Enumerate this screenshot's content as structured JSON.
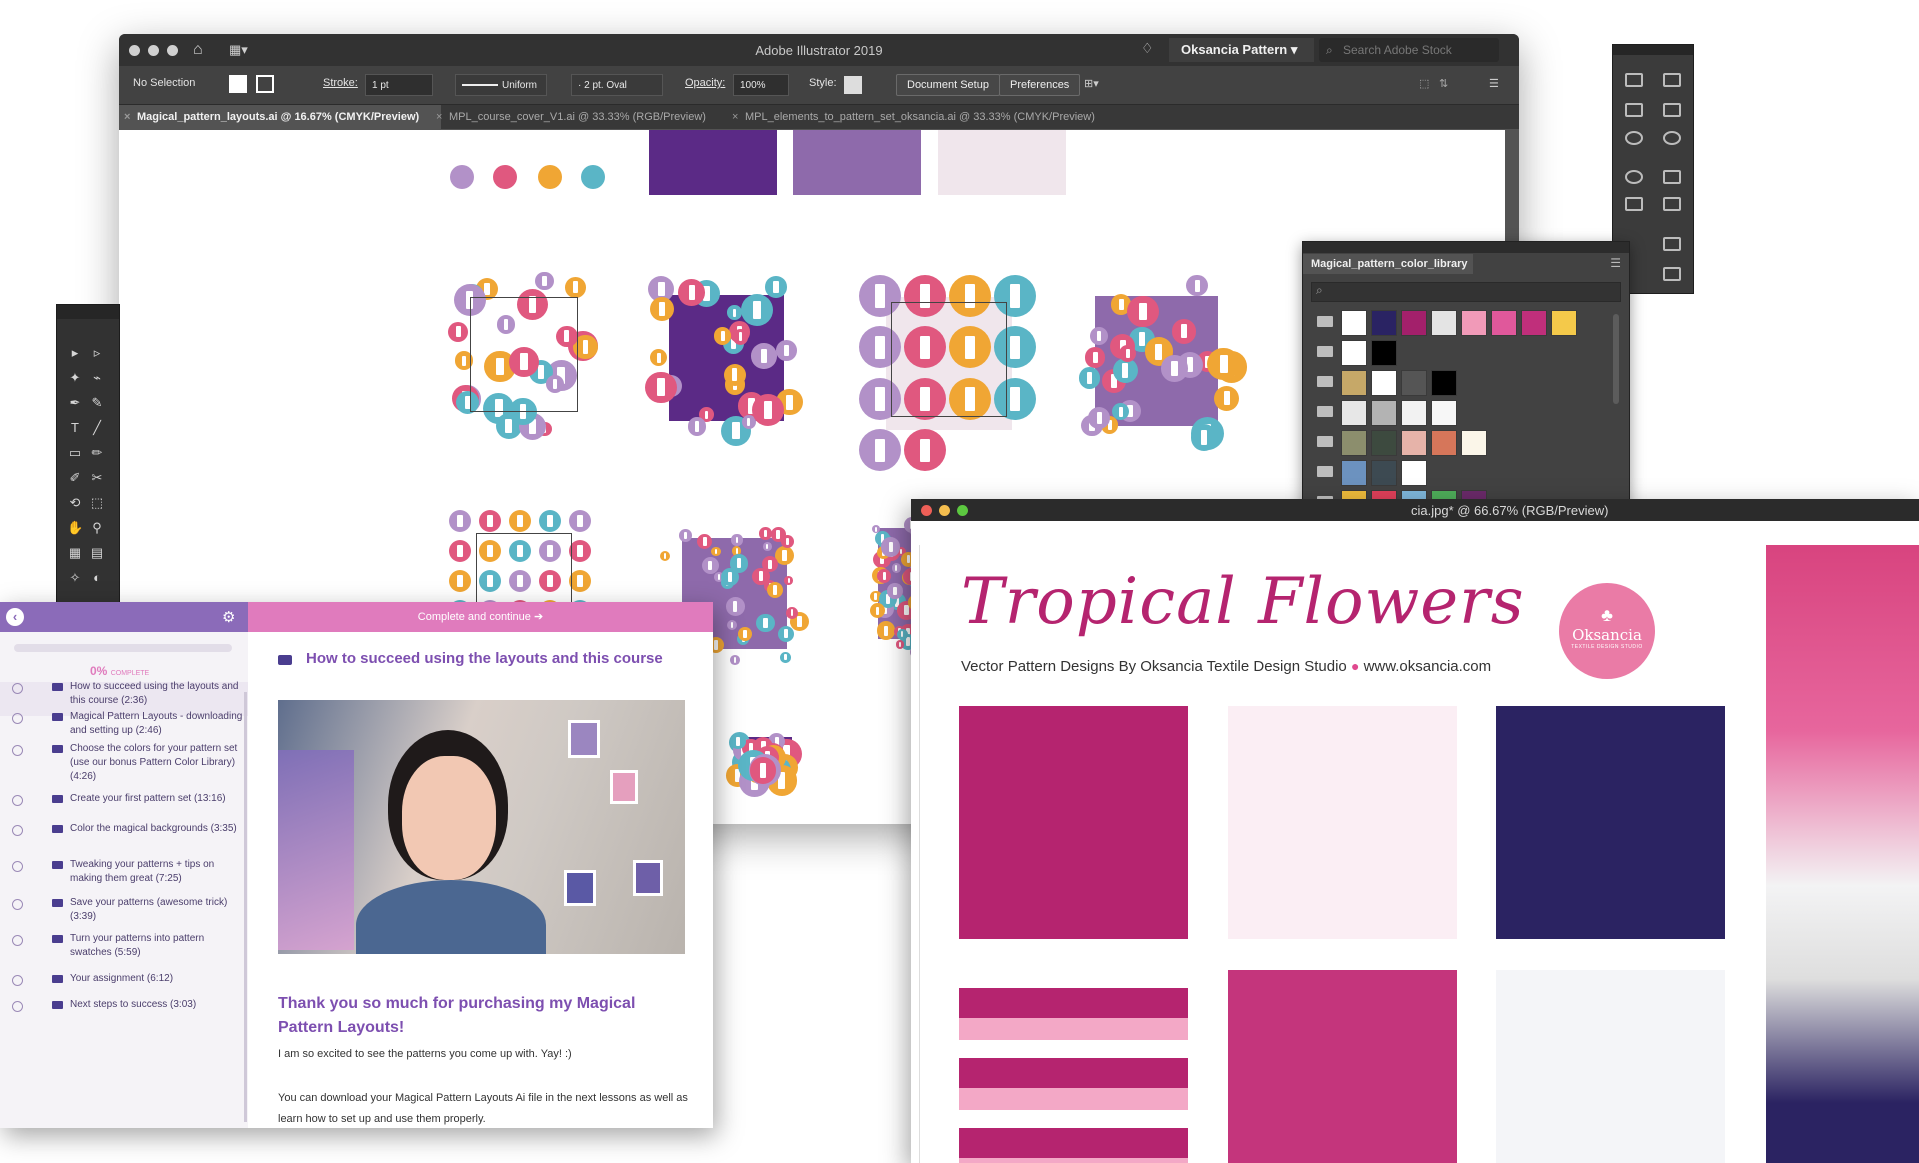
{
  "illustrator": {
    "app_title": "Adobe Illustrator 2019",
    "workspace": "Oksancia Pattern",
    "search_placeholder": "Search Adobe Stock",
    "control_bar": {
      "selection": "No Selection",
      "stroke_label": "Stroke:",
      "stroke_value": "1 pt",
      "profile": "Uniform",
      "brush": "2 pt. Oval",
      "opacity_label": "Opacity:",
      "opacity_value": "100%",
      "style_label": "Style:",
      "document_setup": "Document Setup",
      "preferences": "Preferences"
    },
    "tabs": [
      {
        "label": "Magical_pattern_layouts.ai @ 16.67% (CMYK/Preview)",
        "active": true
      },
      {
        "label": "MPL_course_cover_V1.ai @ 33.33% (RGB/Preview)",
        "active": false
      },
      {
        "label": "MPL_elements_to_pattern_set_oksancia.ai @ 33.33% (CMYK/Preview)",
        "active": false
      }
    ],
    "palette": [
      "#5b2a86",
      "#8e6aab",
      "#f0e6ec"
    ],
    "accent_colors": [
      "#b291c8",
      "#e0587f",
      "#f0a634",
      "#5ab5c6"
    ]
  },
  "swatches_panel": {
    "title": "Magical_pattern_color_library",
    "rows": [
      [
        "#ffffff",
        "#2a2363",
        "#a3206b",
        "#e4e4e4",
        "#f19ab8",
        "#e0589b",
        "#c02f7b",
        "#f4c94a"
      ],
      [
        "#ffffff",
        "#000000"
      ],
      [
        "#c6a868",
        "#ffffff",
        "#555555",
        "#000000"
      ],
      [
        "#e7e7e7",
        "#b3b3b3",
        "#f2f2f2",
        "#f7f7f7"
      ],
      [
        "#8c8e6d",
        "#3d4a3f",
        "#e6b3a9",
        "#d6765a",
        "#fbf6e9"
      ],
      [
        "#6c92bf",
        "#3d4a52",
        "#ffffff"
      ],
      [
        "#efbc3c",
        "#e0405a",
        "#7fb7dc",
        "#4fae5a",
        "#6b2a6a"
      ],
      [
        "#d6dd6a",
        "#52b7c0",
        "#f19e3c",
        "#e0497f",
        "#c58bc0"
      ]
    ]
  },
  "course": {
    "cta": "Complete and continue",
    "progress": "0%",
    "progress_label": "COMPLETE",
    "progress_value": 0,
    "lesson_heading": "How to succeed using the layouts and this course",
    "lessons": [
      "How to succeed using the layouts and this course (2:36)",
      "Magical Pattern Layouts - downloading and setting up (2:46)",
      "Choose the colors for your pattern set (use our bonus Pattern Color Library) (4:26)",
      "Create your first pattern set (13:16)",
      "Color the magical backgrounds (3:35)",
      "Tweaking your patterns + tips on making them great (7:25)",
      "Save your patterns (awesome trick) (3:39)",
      "Turn your patterns into pattern swatches (5:59)",
      "Your assignment (6:12)",
      "Next steps to success (3:03)"
    ],
    "thanks_heading": "Thank you so much for purchasing my Magical Pattern Layouts!",
    "para1": "I am so excited to see the patterns you come up with. Yay! :)",
    "para2": "You can download your Magical Pattern Layouts Ai file in the next lessons as well as learn how to set up and use them properly."
  },
  "tropical": {
    "window_title": "cia.jpg* @ 66.67% (RGB/Preview)",
    "heading": "Tropical Flowers",
    "subheading": "Vector Pattern Designs By Oksancia Textile Design Studio",
    "website": "www.oksancia.com",
    "logo_name": "Oksancia",
    "logo_tag": "TEXTILE DESIGN STUDIO",
    "colors": {
      "magenta": "#b5246f",
      "navy": "#2b2362",
      "pink": "#e9689f"
    }
  }
}
